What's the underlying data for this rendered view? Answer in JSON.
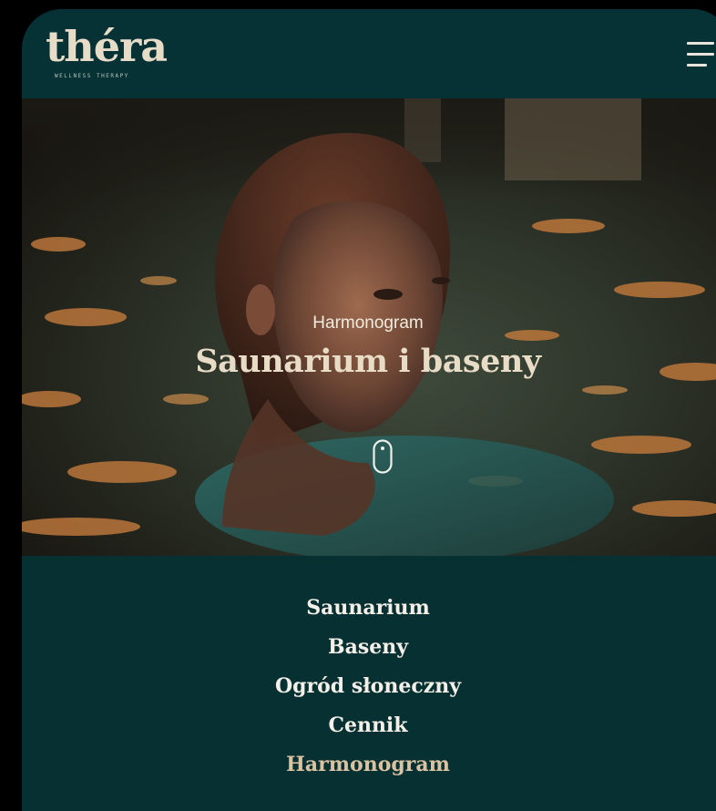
{
  "brand": {
    "name": "théra",
    "tagline": "WELLNESS THERAPY"
  },
  "header": {
    "menu_icon": "hamburger-menu-icon"
  },
  "hero": {
    "eyebrow": "Harmonogram",
    "title": "Saunarium i baseny",
    "scroll_icon": "mouse-scroll-icon"
  },
  "nav": {
    "items": [
      {
        "label": "Saunarium"
      },
      {
        "label": "Baseny"
      },
      {
        "label": "Ogród słoneczny"
      },
      {
        "label": "Cennik"
      },
      {
        "label": "Harmonogram",
        "active": true
      }
    ]
  },
  "colors": {
    "background": "#073033",
    "accent": "#d9c3a2",
    "text": "#f4f0e8"
  }
}
